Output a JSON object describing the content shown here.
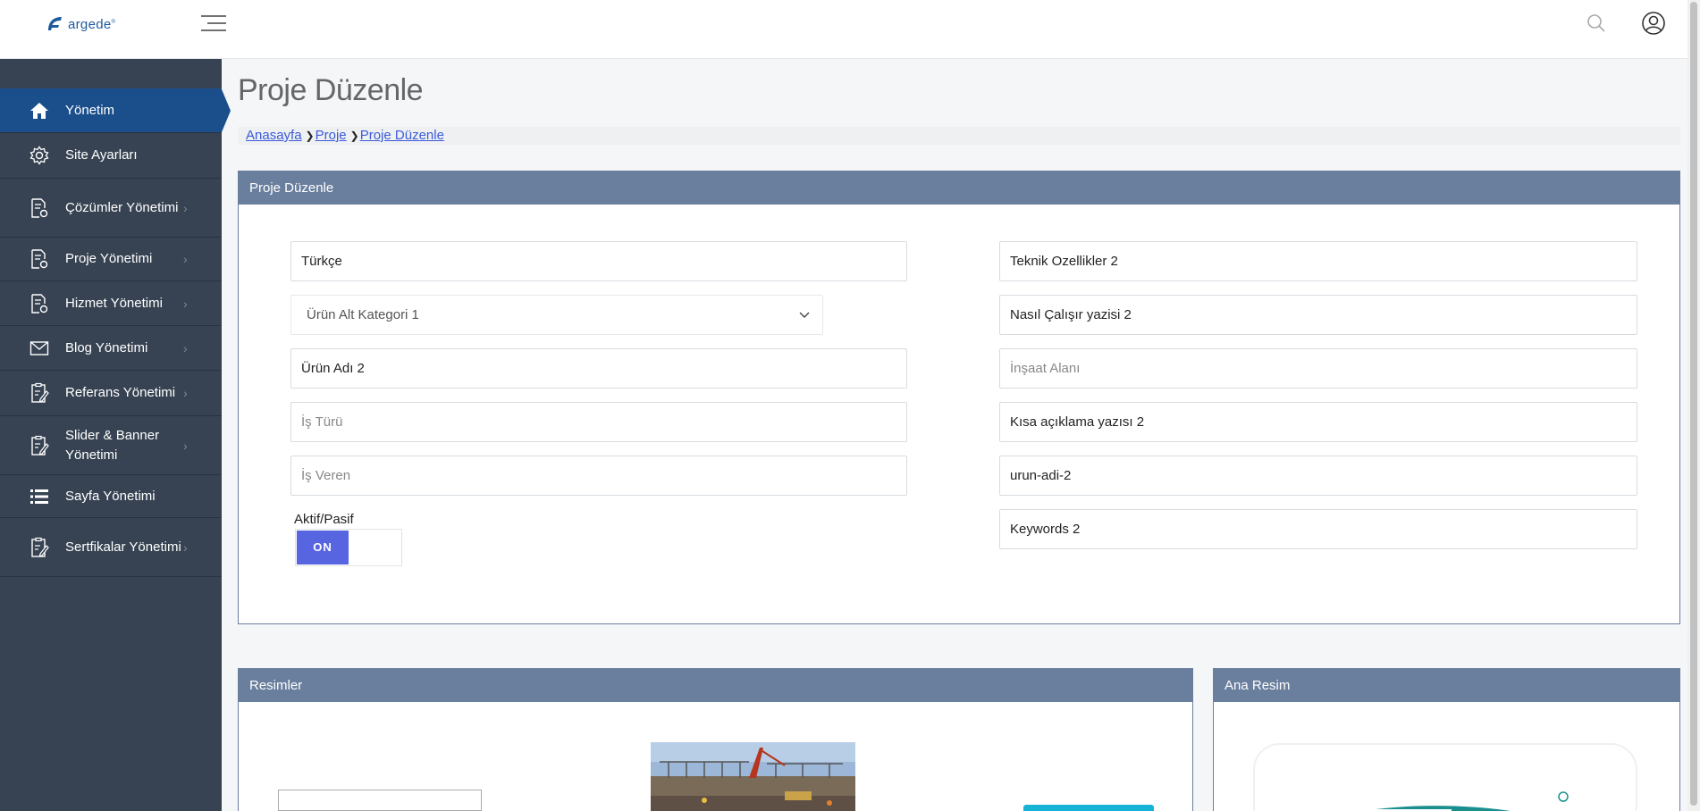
{
  "brand": {
    "name": "argede",
    "mark": "®"
  },
  "header": {
    "menu_icon": "hamburger-menu-icon",
    "search_icon": "search-icon",
    "user_icon": "user-circle-icon"
  },
  "sidebar": {
    "items": [
      {
        "label": "Yönetim",
        "icon": "home-icon",
        "active": true
      },
      {
        "label": "Site Ayarları",
        "icon": "gear-icon"
      },
      {
        "label": "Çözümler Yönetimi",
        "icon": "document-gear-icon",
        "arrow": "›"
      },
      {
        "label": "Proje Yönetimi",
        "icon": "document-gear-icon",
        "arrow": "›"
      },
      {
        "label": "Hizmet Yönetimi",
        "icon": "document-gear-icon",
        "arrow": "›"
      },
      {
        "label": "Blog Yönetimi",
        "icon": "envelope-icon",
        "arrow": "›"
      },
      {
        "label": "Referans Yönetimi",
        "icon": "clipboard-edit-icon",
        "arrow": "›"
      },
      {
        "label": "Slider & Banner Yönetimi",
        "icon": "clipboard-edit-icon",
        "arrow": "›"
      },
      {
        "label": "Sayfa Yönetimi",
        "icon": "list-icon"
      },
      {
        "label": "Sertfikalar Yönetimi",
        "icon": "clipboard-edit-icon",
        "arrow": "›"
      }
    ]
  },
  "page": {
    "title": "Proje Düzenle"
  },
  "breadcrumb": [
    "Anasayfa",
    "Proje",
    "Proje Düzenle"
  ],
  "form_panel": {
    "title": "Proje Düzenle",
    "left": {
      "language": "Türkçe",
      "category_select": "Ürün Alt Kategori 1",
      "product_name": "Ürün Adı 2",
      "job_type_placeholder": "İş Türü",
      "employer_placeholder": "İş Veren",
      "toggle_label": "Aktif/Pasif",
      "toggle_state": "ON"
    },
    "right": {
      "technical": "Teknik Ozellikler  2",
      "how_it_works": "Nasıl Çalışır yazisi 2",
      "construction_area_placeholder": "İnşaat Alanı",
      "short_description": "Kısa açıklama yazısı 2",
      "slug": "urun-adi-2",
      "keywords": "Keywords 2"
    }
  },
  "images_panel": {
    "title": "Resimler"
  },
  "main_image_panel": {
    "title": "Ana Resim"
  },
  "colors": {
    "sidebar": "#374352",
    "active": "#1a4f8c",
    "panel_header": "#6a7f9e",
    "toggle_on": "#5865e0",
    "accent_cyan": "#17b3d6"
  }
}
